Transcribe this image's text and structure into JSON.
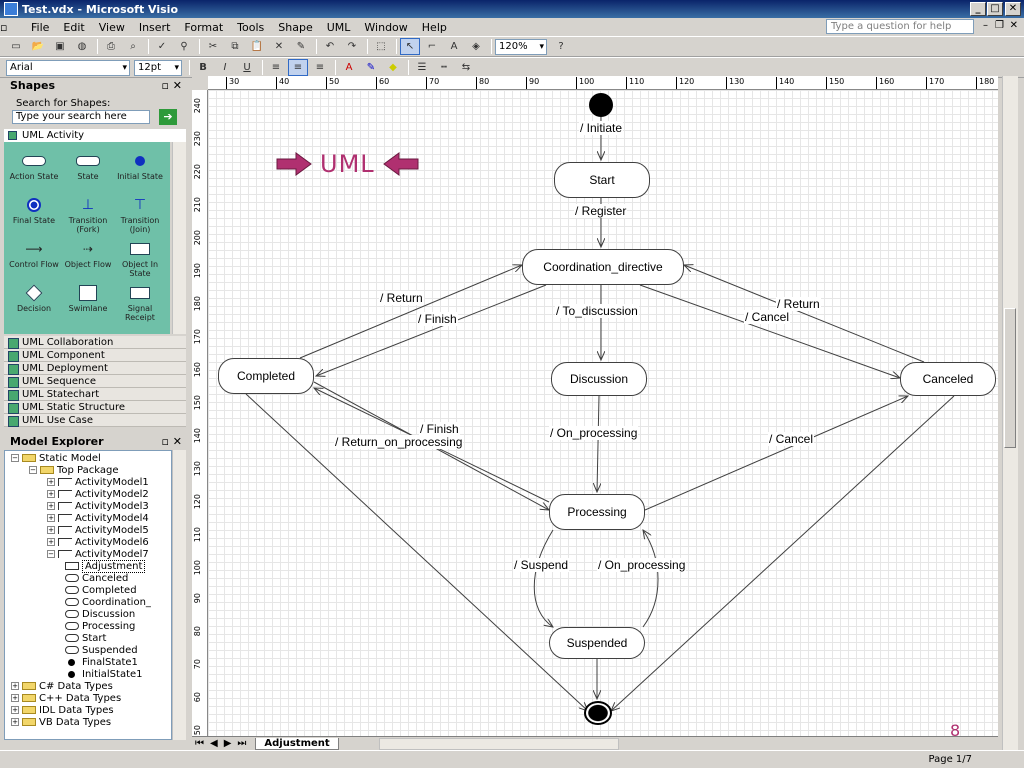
{
  "window": {
    "title": "Test.vdx - Microsoft Visio"
  },
  "menu": {
    "items": [
      "File",
      "Edit",
      "View",
      "Insert",
      "Format",
      "Tools",
      "Shape",
      "UML",
      "Window",
      "Help"
    ],
    "help_placeholder": "Type a question for help"
  },
  "toolbar": {
    "zoom": "120%",
    "font": "Arial",
    "font_size": "12pt",
    "bold": "B",
    "italic": "I",
    "underline": "U"
  },
  "shapes_pane": {
    "title": "Shapes",
    "search_label": "Search for Shapes:",
    "search_placeholder": "Type your search here",
    "active_stencil": "UML Activity",
    "shapes": [
      {
        "label": "Action State"
      },
      {
        "label": "State"
      },
      {
        "label": "Initial State"
      },
      {
        "label": "Final State"
      },
      {
        "label": "Transition (Fork)"
      },
      {
        "label": "Transition (Join)"
      },
      {
        "label": "Control Flow"
      },
      {
        "label": "Object Flow"
      },
      {
        "label": "Object In State"
      },
      {
        "label": "Decision"
      },
      {
        "label": "Swimlane"
      },
      {
        "label": "Signal Receipt"
      }
    ],
    "stencils": [
      "UML Collaboration",
      "UML Component",
      "UML Deployment",
      "UML Sequence",
      "UML Statechart",
      "UML Static Structure",
      "UML Use Case"
    ]
  },
  "model_explorer": {
    "title": "Model Explorer",
    "nodes": [
      {
        "label": "Static Model",
        "level": 0,
        "exp": "−"
      },
      {
        "label": "Top Package",
        "level": 1,
        "exp": "−"
      },
      {
        "label": "ActivityModel1",
        "level": 2,
        "exp": "+"
      },
      {
        "label": "ActivityModel2",
        "level": 2,
        "exp": "+"
      },
      {
        "label": "ActivityModel3",
        "level": 2,
        "exp": "+"
      },
      {
        "label": "ActivityModel4",
        "level": 2,
        "exp": "+"
      },
      {
        "label": "ActivityModel5",
        "level": 2,
        "exp": "+"
      },
      {
        "label": "ActivityModel6",
        "level": 2,
        "exp": "+"
      },
      {
        "label": "ActivityModel7",
        "level": 2,
        "exp": "−"
      },
      {
        "label": "Adjustment",
        "level": 3,
        "exp": "",
        "selected": true
      },
      {
        "label": "Canceled",
        "level": 3,
        "exp": ""
      },
      {
        "label": "Completed",
        "level": 3,
        "exp": ""
      },
      {
        "label": "Coordination_",
        "level": 3,
        "exp": ""
      },
      {
        "label": "Discussion",
        "level": 3,
        "exp": ""
      },
      {
        "label": "Processing",
        "level": 3,
        "exp": ""
      },
      {
        "label": "Start",
        "level": 3,
        "exp": ""
      },
      {
        "label": "Suspended",
        "level": 3,
        "exp": ""
      },
      {
        "label": "FinalState1",
        "level": 3,
        "exp": ""
      },
      {
        "label": "InitialState1",
        "level": 3,
        "exp": ""
      },
      {
        "label": "C# Data Types",
        "level": 0,
        "exp": "+"
      },
      {
        "label": "C++ Data Types",
        "level": 0,
        "exp": "+"
      },
      {
        "label": "IDL Data Types",
        "level": 0,
        "exp": "+"
      },
      {
        "label": "VB Data Types",
        "level": 0,
        "exp": "+"
      }
    ]
  },
  "ruler": {
    "top": [
      "30",
      "40",
      "50",
      "60",
      "70",
      "80",
      "90",
      "100",
      "110",
      "120",
      "130",
      "140",
      "150",
      "160",
      "170",
      "180"
    ],
    "left": [
      "240",
      "230",
      "220",
      "210",
      "200",
      "190",
      "180",
      "170",
      "160",
      "150",
      "140",
      "130",
      "120",
      "110",
      "100",
      "90",
      "80",
      "70",
      "60",
      "50"
    ]
  },
  "diagram": {
    "banner": "UML",
    "page_number": "8",
    "states": {
      "start": "Start",
      "coordination": "Coordination_directive",
      "discussion": "Discussion",
      "completed": "Completed",
      "canceled": "Canceled",
      "processing": "Processing",
      "suspended": "Suspended"
    },
    "transitions": {
      "initiate": "/ Initiate",
      "register": "/ Register",
      "return_left": "/ Return",
      "finish_top": "/ Finish",
      "to_discussion": "/ To_discussion",
      "return_right": "/ Return",
      "cancel_top": "/ Cancel",
      "finish_mid": "/ Finish",
      "return_on_processing": "/ Return_on_processing",
      "on_processing": "/ On_processing",
      "cancel_mid": "/ Cancel",
      "suspend": "/ Suspend",
      "on_processing_2": "/ On_processing"
    }
  },
  "page_tab": "Adjustment",
  "status": {
    "page": "Page 1/7"
  },
  "colors": {
    "banner": "#b03070",
    "stencil_bg": "#6fc0a8",
    "title_bar": "#0a246a"
  }
}
